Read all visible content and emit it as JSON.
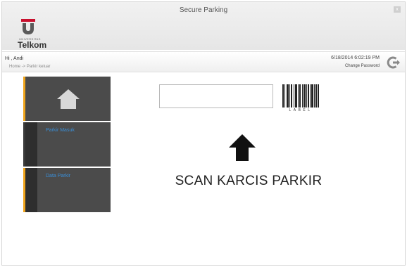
{
  "window": {
    "title": "Secure Parking",
    "close_glyph": "x"
  },
  "logo": {
    "university": "UNIVERSITAS",
    "name": "Telkom"
  },
  "infobar": {
    "greeting": "Hi , Andi",
    "breadcrumb": "Home -> Parkir keluar",
    "datetime": "6/18/2014 6:02:19 PM",
    "change_password": "Change Password",
    "logout_icon": "power-icon"
  },
  "sidebar": {
    "items": [
      {
        "label": "",
        "icon": "home-icon"
      },
      {
        "label": "Parkir Masuk"
      },
      {
        "label": "Data Parkir"
      }
    ]
  },
  "main": {
    "scan_input_value": "",
    "barcode_label": "LABEL",
    "arrow_icon": "up-arrow-icon",
    "scan_text": "SCAN KARCIS PARKIR"
  },
  "colors": {
    "accent": "#f0a51c",
    "tile": "#4b4b4b",
    "tile_label": "#3a8fd8"
  }
}
